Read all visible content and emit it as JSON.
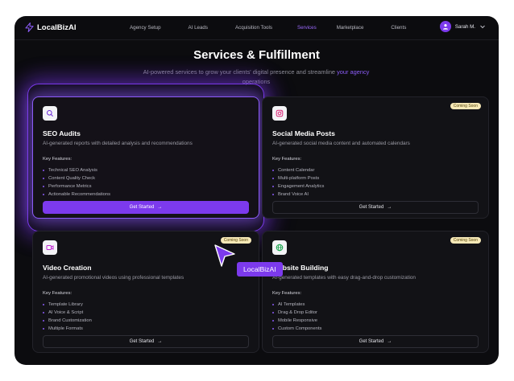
{
  "nav": {
    "brand": "LocalBizAI",
    "links": [
      "Agency Setup",
      "AI Leads",
      "Acquisition Tools",
      "Services",
      "Marketplace",
      "Clients"
    ],
    "active_index": 3,
    "user_name": "Sarah M.",
    "accent": "#7c3aed"
  },
  "hero": {
    "title": "Services & Fulfillment",
    "subtitle_pre": "AI-powered services to grow your clients' digital presence and streamline",
    "subtitle_hl": "your agency",
    "subtitle_post": " operations"
  },
  "cards": [
    {
      "icon": "search-icon",
      "title": "SEO Audits",
      "desc": "AI-generated reports with detailed analysis and recommendations",
      "kf_label": "Key Features:",
      "features": [
        "Technical SEO Analysis",
        "Content Quality Check",
        "Performance Metrics",
        "Actionable Recommendations"
      ],
      "button": "Get Started",
      "badge": ""
    },
    {
      "icon": "instagram-icon",
      "title": "Social Media Posts",
      "desc": "AI-generated social media content and automated calendars",
      "kf_label": "Key Features:",
      "features": [
        "Content Calendar",
        "Multi-platform Posts",
        "Engagement Analytics",
        "Brand Voice AI"
      ],
      "button": "Get Started",
      "badge": "Coming Soon"
    },
    {
      "icon": "video-icon",
      "title": "Video Creation",
      "desc": "AI-generated promotional videos using professional templates",
      "kf_label": "Key Features:",
      "features": [
        "Template Library",
        "AI Voice & Script",
        "Brand Customization",
        "Multiple Formats"
      ],
      "button": "Get Started",
      "badge": "Coming Soon"
    },
    {
      "icon": "globe-icon",
      "title": "Website Building",
      "desc": "AI-generated templates with easy drag-and-drop customization",
      "kf_label": "Key Features:",
      "features": [
        "AI Templates",
        "Drag & Drop Editor",
        "Mobile Responsive",
        "Custom Components"
      ],
      "button": "Get Started",
      "badge": "Coming Soon"
    }
  ],
  "cursor_label": "LocalBizAI"
}
